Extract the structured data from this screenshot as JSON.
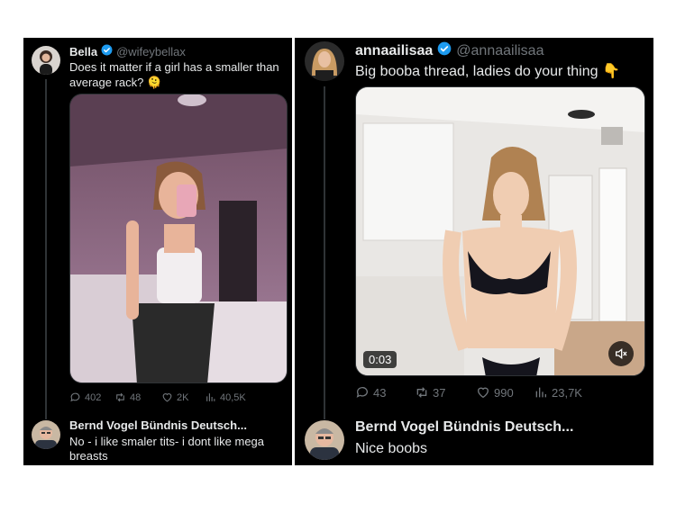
{
  "colors": {
    "accent_verified": "#1d9bf0",
    "text_primary": "#e7e9ea",
    "text_secondary": "#71767b",
    "background": "#000000"
  },
  "left": {
    "post": {
      "name": "Bella",
      "handle": "@wifeybellax",
      "text": "Does it matter if a girl has a smaller than average rack? 🫠",
      "stats": {
        "replies": "402",
        "reposts": "48",
        "likes": "2K",
        "views": "40,5K"
      }
    },
    "reply": {
      "name": "Bernd Vogel Bündnis Deutsch...",
      "text": "No - i like smaler tits- i dont like mega breasts"
    }
  },
  "right": {
    "post": {
      "name": "annaailisaa",
      "handle": "@annaailisaa",
      "text": "Big booba thread, ladies do your thing 👇",
      "video_time": "0:03",
      "stats": {
        "replies": "43",
        "reposts": "37",
        "likes": "990",
        "views": "23,7K"
      }
    },
    "reply": {
      "name": "Bernd Vogel Bündnis Deutsch...",
      "text": "Nice boobs"
    }
  }
}
